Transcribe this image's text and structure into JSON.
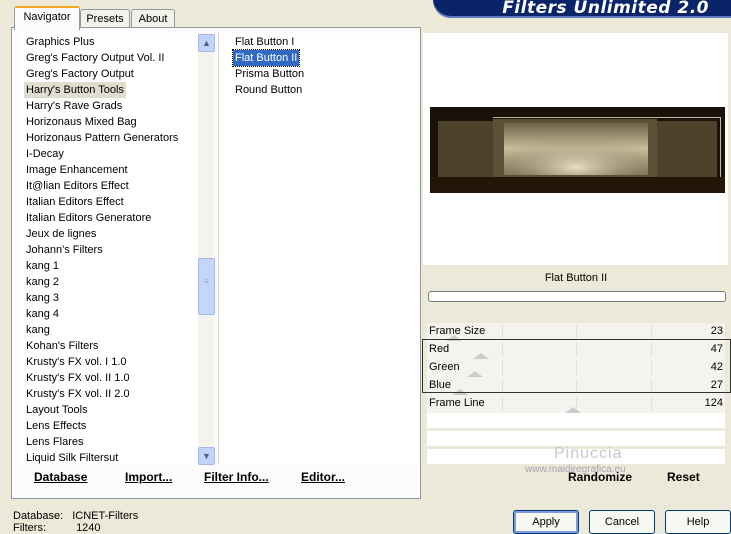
{
  "banner": {
    "title": "Filters Unlimited 2.0"
  },
  "tabs": [
    {
      "label": "Navigator",
      "active": true
    },
    {
      "label": "Presets",
      "active": false
    },
    {
      "label": "About",
      "active": false
    }
  ],
  "categories": {
    "selected": "Harry's Button Tools",
    "items": [
      "Graphics Plus",
      "Greg's Factory Output Vol. II",
      "Greg's Factory Output",
      "Harry's Button Tools",
      "Harry's Rave Grads",
      "Horizonaus Mixed Bag",
      "Horizonaus Pattern Generators",
      "I-Decay",
      "Image Enhancement",
      "It@lian Editors Effect",
      "Italian Editors Effect",
      "Italian Editors Generatore",
      "Jeux de lignes",
      "Johann's Filters",
      "kang 1",
      "kang 2",
      "kang 3",
      "kang 4",
      "kang",
      "Kohan's Filters",
      "Krusty's FX vol. I 1.0",
      "Krusty's FX vol. II 1.0",
      "Krusty's FX vol. II 2.0",
      "Layout Tools",
      "Lens Effects",
      "Lens Flares",
      "Liquid Silk Filtersut"
    ]
  },
  "filters": {
    "selected": "Flat Button II",
    "items": [
      "Flat Button I",
      "Flat Button II",
      "Prisma Button",
      "Round Button"
    ]
  },
  "left_buttons": {
    "database": "Database",
    "import": "Import...",
    "filter_info": "Filter Info...",
    "editor": "Editor..."
  },
  "preview": {
    "filter_name": "Flat Button II"
  },
  "params": [
    {
      "label": "Frame Size",
      "value": "23",
      "level": 0.09
    },
    {
      "label": "Red",
      "value": "47",
      "level": 0.18
    },
    {
      "label": "Green",
      "value": "42",
      "level": 0.16
    },
    {
      "label": "Blue",
      "value": "27",
      "level": 0.11
    },
    {
      "label": "Frame Line",
      "value": "124",
      "level": 0.49
    }
  ],
  "right_buttons": {
    "randomize": "Randomize",
    "reset": "Reset"
  },
  "watermark": {
    "name": "Pinuccia",
    "site": "www.maidiregrafica.eu"
  },
  "status": {
    "database_label": "Database:",
    "database_value": "ICNET-Filters",
    "filters_label": "Filters:",
    "filters_value": "1240"
  },
  "dialog_buttons": {
    "apply": "Apply",
    "cancel": "Cancel",
    "help": "Help"
  },
  "colors": {
    "accent": "#316ac5",
    "banner": "#0a246a",
    "tab_highlight": "#f5a623"
  }
}
